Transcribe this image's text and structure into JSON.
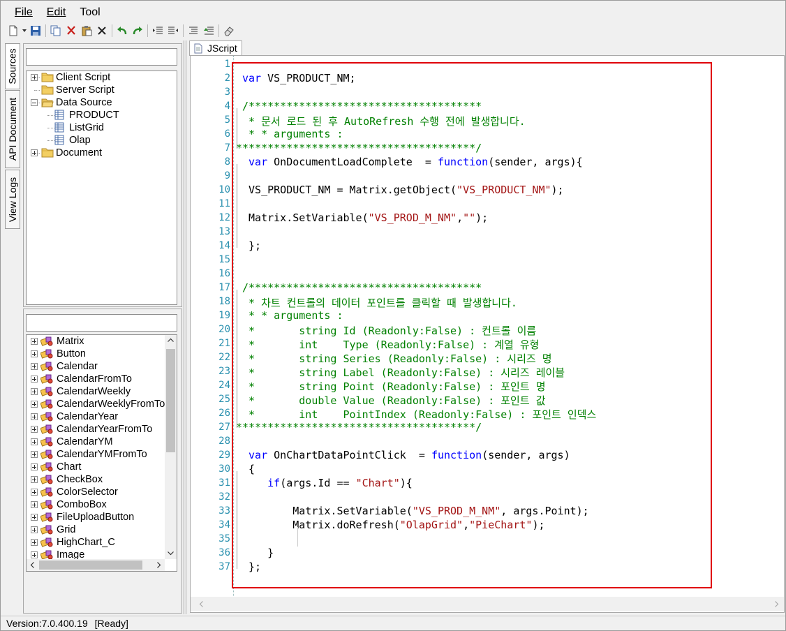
{
  "menu": {
    "file": "File",
    "edit": "Edit",
    "tool": "Tool"
  },
  "toolbar": {
    "buttons": [
      "new-document-icon",
      "dropdown-arrow-icon",
      "save-icon",
      "copy-icon",
      "cut-icon",
      "paste-icon",
      "delete-icon",
      "undo-icon",
      "redo-icon",
      "indent-icon",
      "outdent-icon",
      "comment-icon",
      "uncomment-icon",
      "eraser-icon"
    ]
  },
  "side_tabs": {
    "sources": "Sources",
    "api_document": "API Document",
    "view_logs": "View Logs"
  },
  "sources_tree": {
    "search_value": "",
    "items": [
      {
        "label": "Client Script",
        "icon": "folder-icon"
      },
      {
        "label": "Server Script",
        "icon": "folder-icon"
      },
      {
        "label": "Data Source",
        "icon": "folder-open-icon"
      },
      {
        "label": "PRODUCT",
        "icon": "datasource-icon"
      },
      {
        "label": "ListGrid",
        "icon": "datasource-icon"
      },
      {
        "label": "Olap",
        "icon": "datasource-icon"
      },
      {
        "label": "Document",
        "icon": "folder-icon"
      }
    ]
  },
  "controls_tree": {
    "search_value": "",
    "items": [
      "Matrix",
      "Button",
      "Calendar",
      "CalendarFromTo",
      "CalendarWeekly",
      "CalendarWeeklyFromTo",
      "CalendarYear",
      "CalendarYearFromTo",
      "CalendarYM",
      "CalendarYMFromTo",
      "Chart",
      "CheckBox",
      "ColorSelector",
      "ComboBox",
      "FileUploadButton",
      "Grid",
      "HighChart_C",
      "Image"
    ]
  },
  "editor": {
    "tab_label": "JScript",
    "line_numbers": [
      "1",
      "2",
      "3",
      "4",
      "5",
      "6",
      "7",
      "8",
      "9",
      "10",
      "11",
      "12",
      "13",
      "14",
      "15",
      "16",
      "17",
      "18",
      "19",
      "20",
      "21",
      "22",
      "23",
      "24",
      "25",
      "26",
      "27",
      "28",
      "29",
      "30",
      "31",
      "32",
      "33",
      "34",
      "35",
      "36",
      "37"
    ]
  },
  "status": {
    "version": "Version:7.0.400.19",
    "state": "[Ready]"
  },
  "colors": {
    "keyword": "#0000ff",
    "string": "#a31515",
    "comment": "#008000",
    "line_number": "#2b91af",
    "highlight_box": "#e0000a"
  }
}
